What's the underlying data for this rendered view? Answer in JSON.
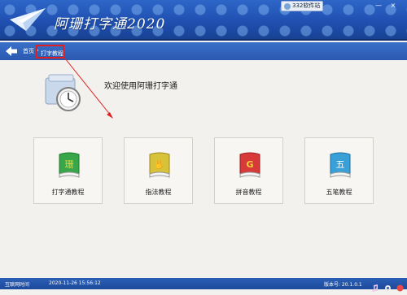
{
  "app": {
    "title": "阿珊打字通2020"
  },
  "user": {
    "name": "332软件站"
  },
  "window_controls": [
    "—",
    "×"
  ],
  "breadcrumb": {
    "home": "首页",
    "separator": "›",
    "current": "打字教程"
  },
  "welcome": {
    "text": "欢迎使用阿珊打字通"
  },
  "cards": [
    {
      "label": "打字通教程",
      "icon": "green-book-icon",
      "glyph": "珊",
      "color": "#3aa64a"
    },
    {
      "label": "指法教程",
      "icon": "yellow-book-icon",
      "glyph": "✋",
      "color": "#d8c23a"
    },
    {
      "label": "拼音教程",
      "icon": "red-book-icon",
      "glyph": "G",
      "color": "#d83a3a"
    },
    {
      "label": "五笔教程",
      "icon": "blue-book-icon",
      "glyph": "五",
      "color": "#3aa0d8"
    }
  ],
  "status": {
    "left": "互联网时间",
    "time": "2020-11-26 15:56:12",
    "version": "版本号: 20.1.0.1"
  },
  "colors": {
    "header": "#1f4fb0",
    "highlight": "#e02020",
    "background": "#f2f1ed"
  }
}
